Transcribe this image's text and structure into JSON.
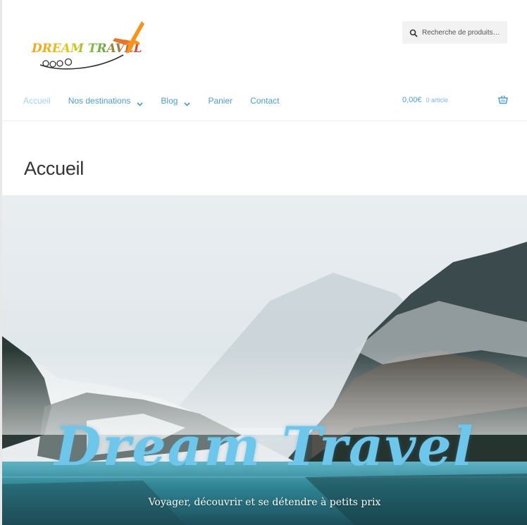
{
  "header": {
    "logo_text": "DREAM TRAVEL",
    "search": {
      "placeholder": "Recherche de produits…",
      "icon": "search-icon"
    },
    "nav": {
      "items": [
        {
          "label": "Accueil",
          "active": true
        },
        {
          "label": "Nos destinations",
          "has_dropdown": true
        },
        {
          "label": "Blog",
          "has_dropdown": true
        },
        {
          "label": "Panier"
        },
        {
          "label": "Contact"
        }
      ]
    },
    "cart": {
      "amount": "0,00€",
      "count": "0 article",
      "icon": "basket-icon"
    }
  },
  "main": {
    "page_title": "Accueil",
    "hero": {
      "title": "Dream Travel",
      "subtitle": "Voyager, découvrir et se détendre à petits prix"
    }
  },
  "colors": {
    "link": "#4a9ecf",
    "active_link": "#9fd4ee",
    "hero_title": "#6ec6ea",
    "title_text": "#333333"
  }
}
